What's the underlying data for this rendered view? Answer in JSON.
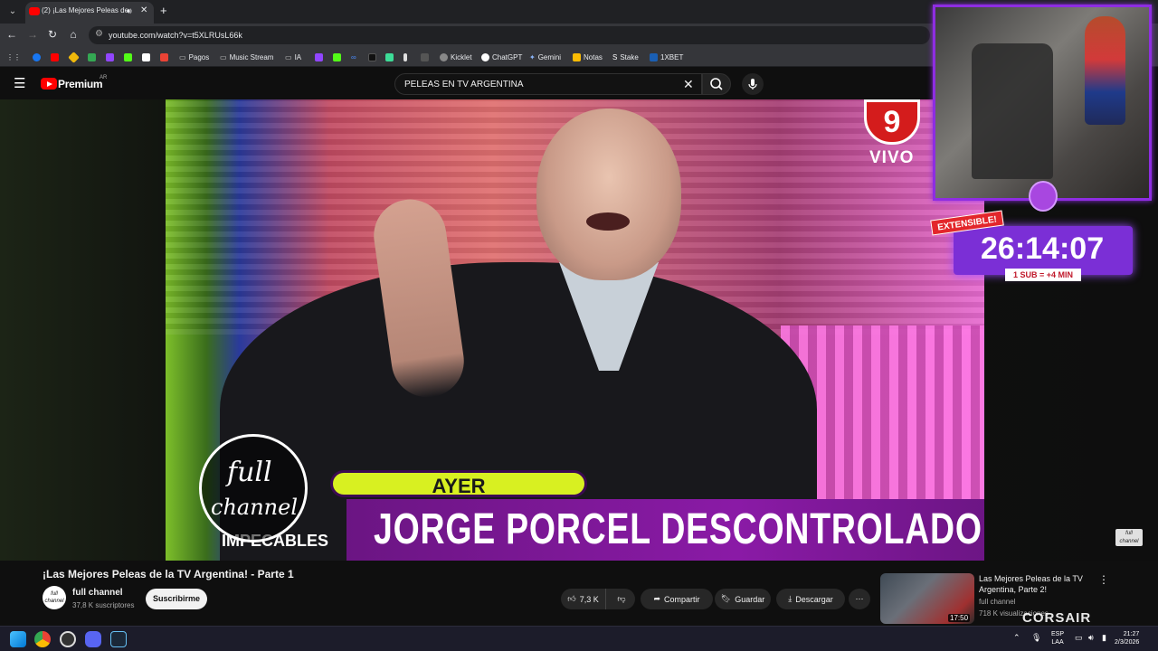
{
  "browser": {
    "tab_title": "(2) ¡Las Mejores Peleas de l",
    "url": "youtube.com/watch?v=t5XLRUsL66k",
    "bookmarks": [
      "Pagos",
      "Music Stream",
      "IA",
      "Kicklet",
      "ChatGPT",
      "Gemini",
      "Notas",
      "Stake",
      "1XBET"
    ]
  },
  "youtube": {
    "brand": "Premium",
    "country": "AR",
    "search_query": "PELEAS EN TV ARGENTINA"
  },
  "video": {
    "channel_bug": "9",
    "vivo": "VIVO",
    "ayer": "AYER",
    "lower_third": "JORGE PORCEL DESCONTROLADO",
    "show_name": "IMPECABLES",
    "badge_line1": "full",
    "badge_line2": "channel",
    "watermark": "full channel"
  },
  "overlay": {
    "extensible_tag": "EXTENSIBLE!",
    "timer": "26:14:07",
    "rule": "1 SUB = +4 MIN",
    "brand": "CORSAIR"
  },
  "watch": {
    "title": "¡Las Mejores Peleas de la TV Argentina! - Parte 1",
    "channel": "full channel",
    "subscribers": "37,8 K suscriptores",
    "subscribe_label": "Suscribirme",
    "likes": "7,3 K",
    "share_label": "Compartir",
    "save_label": "Guardar",
    "download_label": "Descargar"
  },
  "recommendation": {
    "title": "Las Mejores Peleas de la TV Argentina, Parte 2!",
    "channel": "full channel",
    "views": "718 K visualizaciones",
    "duration": "17:50"
  },
  "taskbar": {
    "lang1": "ESP",
    "lang2": "LAA",
    "time": "21:27",
    "date": "2/3/2026"
  }
}
